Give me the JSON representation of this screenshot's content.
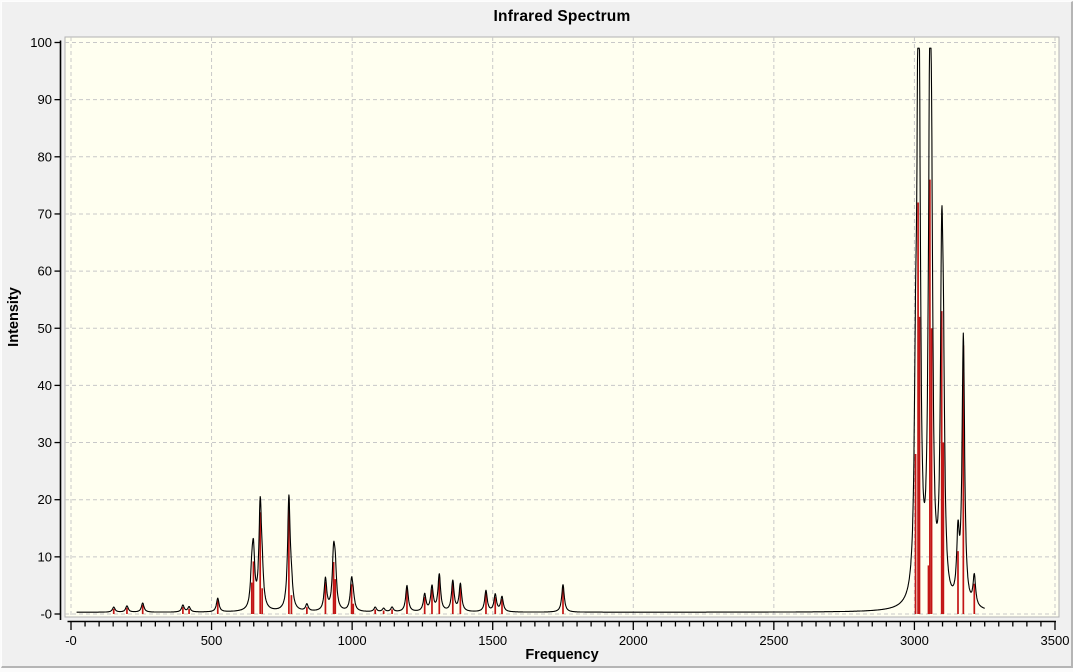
{
  "chart_data": {
    "type": "line",
    "title": "Infrared Spectrum",
    "xlabel": "Frequency",
    "ylabel": "Intensity",
    "xlim": [
      -21,
      3515
    ],
    "ylim": [
      -0.5,
      101
    ],
    "x_major_ticks": [
      0,
      500,
      1000,
      1500,
      2000,
      2500,
      3000,
      3500
    ],
    "x_tick_labels": [
      "-0",
      "500",
      "1000",
      "1500",
      "2000",
      "2500",
      "3000",
      "3500"
    ],
    "x_minor_step": 50,
    "y_ticks": [
      0,
      10,
      20,
      30,
      40,
      50,
      60,
      70,
      80,
      90,
      100
    ],
    "y_tick_labels": [
      "-0",
      "10",
      "20",
      "30",
      "40",
      "50",
      "60",
      "70",
      "80",
      "90",
      "100"
    ],
    "grid": "dashed-both-axes",
    "legend": "none",
    "series": [
      {
        "name": "broadened spectrum curve",
        "type": "lorentzian_sum",
        "color": "#000000",
        "gamma": 5.5,
        "baseline_offset": 0.3,
        "clip_max": 99,
        "x_start": 20,
        "x_end": 3250
      },
      {
        "name": "stick spectrum",
        "type": "sticks",
        "color": "#c31515"
      }
    ],
    "peaks": [
      [
        152,
        0.9
      ],
      [
        199,
        1.1
      ],
      [
        255,
        1.6
      ],
      [
        398,
        1.2
      ],
      [
        420,
        0.9
      ],
      [
        522,
        2.4
      ],
      [
        643,
        5.5
      ],
      [
        649,
        9.2
      ],
      [
        673,
        17.8
      ],
      [
        680,
        4.5
      ],
      [
        775,
        19.5
      ],
      [
        784,
        3.3
      ],
      [
        839,
        1.2
      ],
      [
        905,
        5.6
      ],
      [
        934,
        9.1
      ],
      [
        940,
        6.1
      ],
      [
        998,
        5.2
      ],
      [
        1004,
        1.8
      ],
      [
        1082,
        0.8
      ],
      [
        1112,
        0.6
      ],
      [
        1142,
        0.8
      ],
      [
        1195,
        4.6
      ],
      [
        1258,
        3.0
      ],
      [
        1284,
        4.3
      ],
      [
        1310,
        6.4
      ],
      [
        1358,
        5.3
      ],
      [
        1385,
        4.8
      ],
      [
        1476,
        3.7
      ],
      [
        1509,
        3.0
      ],
      [
        1533,
        2.6
      ],
      [
        1750,
        4.8
      ],
      [
        3004,
        28
      ],
      [
        3013,
        72
      ],
      [
        3018,
        52
      ],
      [
        3050,
        8.5
      ],
      [
        3055,
        76
      ],
      [
        3061,
        50
      ],
      [
        3097,
        53
      ],
      [
        3103,
        30
      ],
      [
        3155,
        11
      ],
      [
        3174,
        47
      ],
      [
        3213,
        5.3
      ]
    ]
  },
  "colors": {
    "window_bg": "#f0f0f0",
    "plot_bg": "#fffff0",
    "plot_border": "#b2b2b2",
    "grid": "#c8c8c8",
    "curve": "#000000",
    "sticks": "#c31515",
    "text": "#000000"
  }
}
